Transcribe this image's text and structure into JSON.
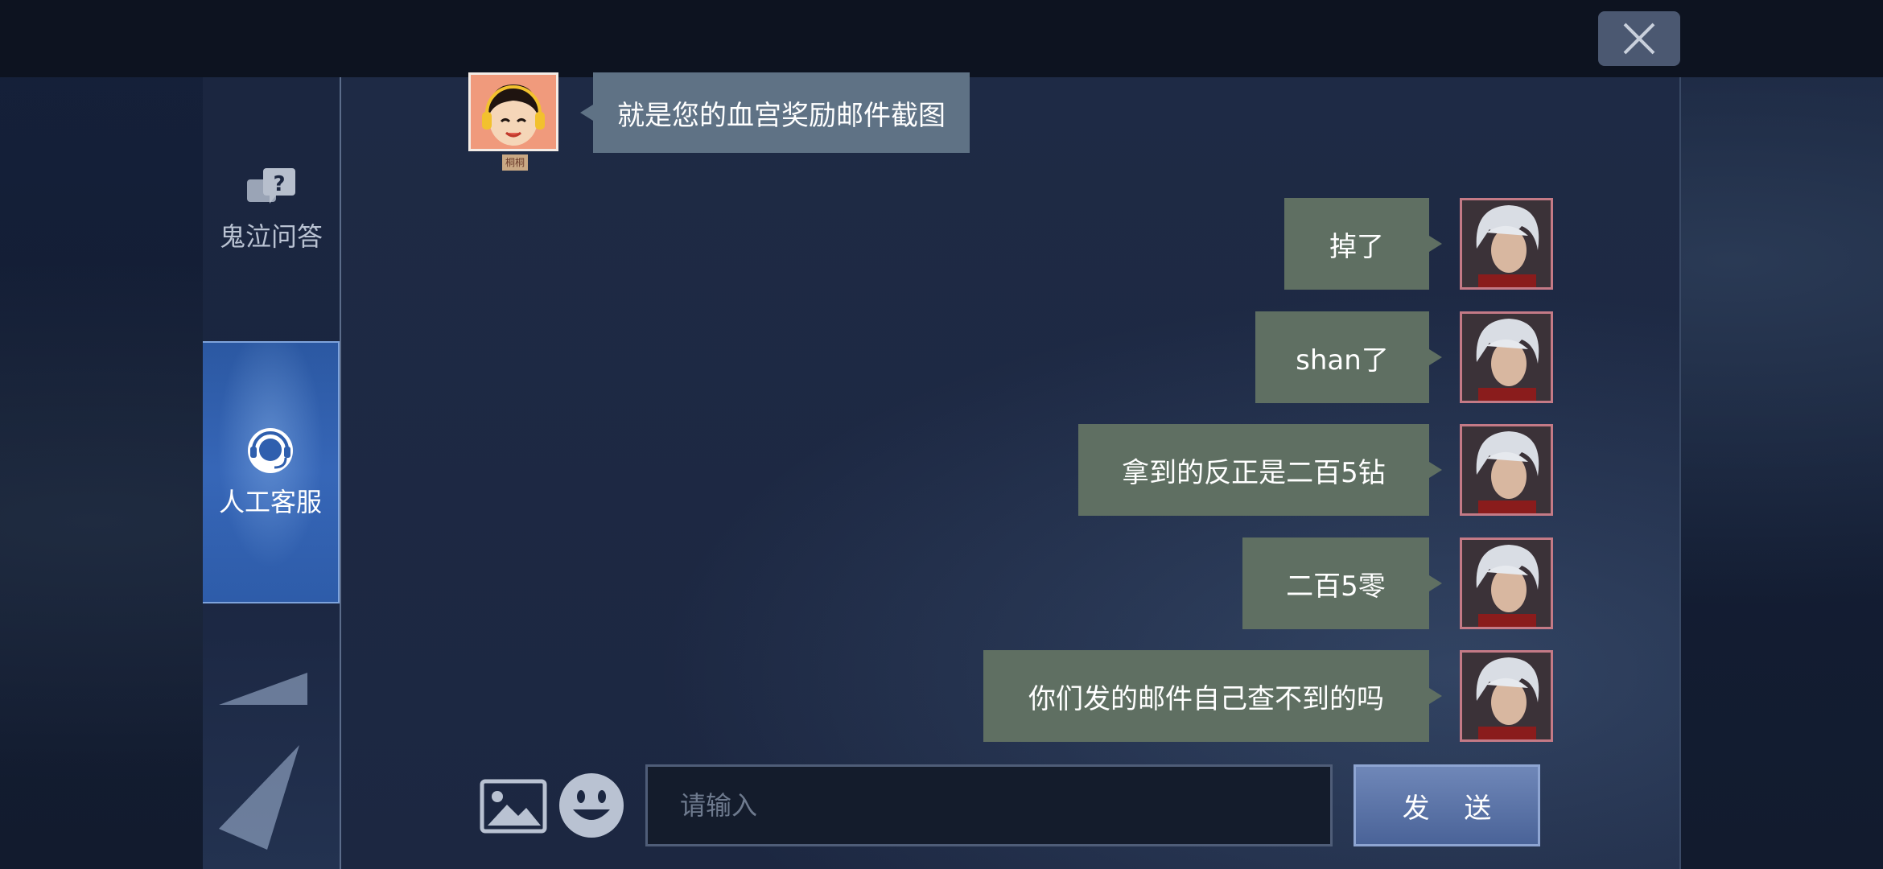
{
  "window": {
    "close_icon": "close-icon"
  },
  "sidebar": {
    "items": [
      {
        "label": "鬼泣问答",
        "icon": "question-chat-icon",
        "active": false
      },
      {
        "label": "人工客服",
        "icon": "headset-agent-icon",
        "active": true
      }
    ]
  },
  "chat": {
    "agent_message": {
      "text": "就是您的血宫奖励邮件截图",
      "tag": "桐桐"
    },
    "user_messages": [
      {
        "text": "掉了"
      },
      {
        "text": "shan了"
      },
      {
        "text": "拿到的反正是二百5钻"
      },
      {
        "text": "二百5零"
      },
      {
        "text": "你们发的邮件自己查不到的吗"
      }
    ]
  },
  "input_bar": {
    "image_icon": "image-icon",
    "emoji_icon": "emoji-icon",
    "placeholder": "请输入",
    "value": "",
    "send_label": "发 送"
  },
  "colors": {
    "user_bubble": "#5f6f62",
    "agent_bubble": "#5f7285",
    "active_tab": "#2c5aa5"
  }
}
